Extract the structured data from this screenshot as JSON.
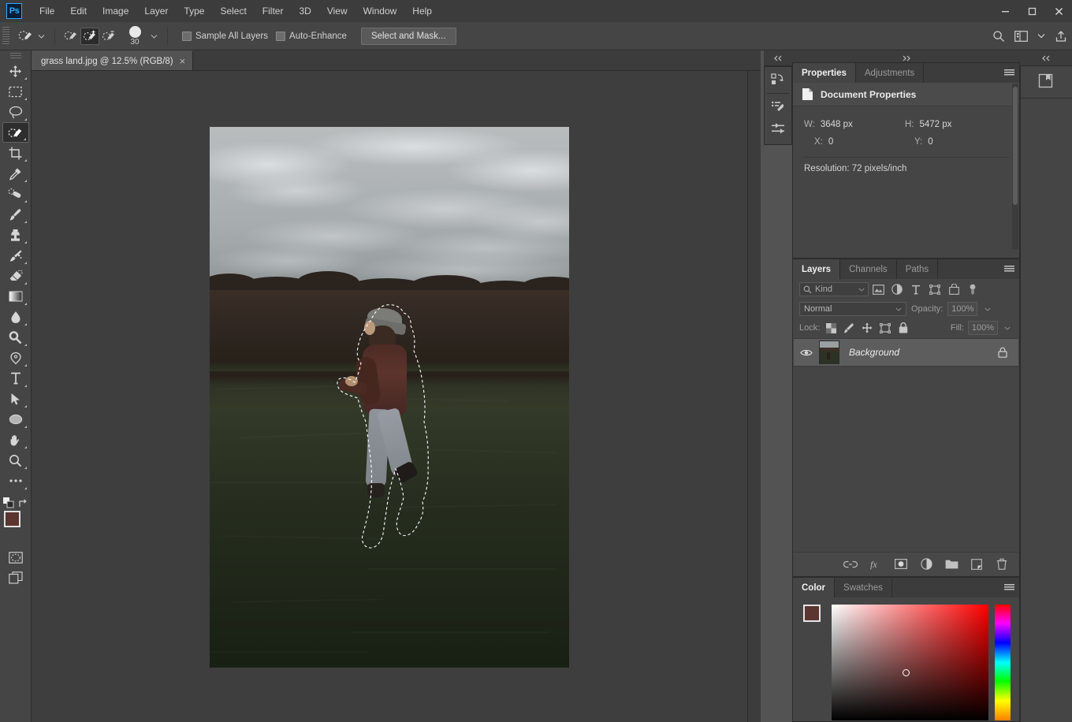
{
  "app": {
    "logo": "Ps",
    "menus": [
      "File",
      "Edit",
      "Image",
      "Layer",
      "Type",
      "Select",
      "Filter",
      "3D",
      "View",
      "Window",
      "Help"
    ],
    "window_controls": {
      "minimize": "minimize-icon",
      "maximize": "maximize-icon",
      "close": "close-icon"
    }
  },
  "options_bar": {
    "tool_preset_icon": "quick-selection-tool-icon",
    "modes": [
      {
        "name": "new-selection",
        "active": false
      },
      {
        "name": "add-to-selection",
        "active": true
      },
      {
        "name": "subtract-from-selection",
        "active": false
      }
    ],
    "brush_size": "30",
    "checkboxes": [
      {
        "label": "Sample All Layers",
        "checked": false
      },
      {
        "label": "Auto-Enhance",
        "checked": false
      }
    ],
    "select_and_mask_label": "Select and Mask...",
    "right_icons": [
      "search-icon",
      "workspace-icon",
      "chevron-down-icon",
      "share-icon"
    ]
  },
  "toolbar": {
    "tools": [
      {
        "name": "move-tool",
        "selected": false
      },
      {
        "name": "rectangular-marquee-tool",
        "selected": false
      },
      {
        "name": "lasso-tool",
        "selected": false
      },
      {
        "name": "quick-selection-tool",
        "selected": true
      },
      {
        "name": "crop-tool",
        "selected": false
      },
      {
        "name": "eyedropper-tool",
        "selected": false
      },
      {
        "name": "spot-healing-brush-tool",
        "selected": false
      },
      {
        "name": "brush-tool",
        "selected": false
      },
      {
        "name": "clone-stamp-tool",
        "selected": false
      },
      {
        "name": "history-brush-tool",
        "selected": false
      },
      {
        "name": "eraser-tool",
        "selected": false
      },
      {
        "name": "gradient-tool",
        "selected": false
      },
      {
        "name": "blur-tool",
        "selected": false
      },
      {
        "name": "dodge-tool",
        "selected": false
      },
      {
        "name": "pen-tool",
        "selected": false
      },
      {
        "name": "type-tool",
        "selected": false
      },
      {
        "name": "path-selection-tool",
        "selected": false
      },
      {
        "name": "ellipse-tool",
        "selected": false
      },
      {
        "name": "hand-tool",
        "selected": false
      },
      {
        "name": "zoom-tool",
        "selected": false
      },
      {
        "name": "edit-toolbar-tool",
        "selected": false
      }
    ],
    "foreground_color": "#5c3530",
    "background_color": "#ffffff",
    "quick_mask": "quick-mask-icon",
    "screen_mode": "screen-mode-icon"
  },
  "document": {
    "tab_title": "grass land.jpg @ 12.5% (RGB/8)",
    "close_label": "×",
    "zoom": "12.5%",
    "color_mode": "RGB/8",
    "filename": "grass land.jpg"
  },
  "properties_panel": {
    "tabs": [
      {
        "label": "Properties",
        "active": true
      },
      {
        "label": "Adjustments",
        "active": false
      }
    ],
    "header": "Document Properties",
    "header_icon": "document-icon",
    "width_label": "W:",
    "width_value": "3648 px",
    "height_label": "H:",
    "height_value": "5472 px",
    "x_label": "X:",
    "x_value": "0",
    "y_label": "Y:",
    "y_value": "0",
    "resolution": "Resolution: 72 pixels/inch",
    "menu_icon": "panel-menu-icon"
  },
  "layers_panel": {
    "tabs": [
      {
        "label": "Layers",
        "active": true
      },
      {
        "label": "Channels",
        "active": false
      },
      {
        "label": "Paths",
        "active": false
      }
    ],
    "filter_label": "Kind",
    "filter_icons": [
      "pixel-layer-filter-icon",
      "adjustment-layer-filter-icon",
      "type-layer-filter-icon",
      "shape-layer-filter-icon",
      "smart-object-filter-icon",
      "toggle-filter-icon"
    ],
    "blend_mode": "Normal",
    "opacity_label": "Opacity:",
    "opacity_value": "100%",
    "lock_label": "Lock:",
    "lock_icons": [
      "lock-transparent-pixels-icon",
      "lock-image-pixels-icon",
      "lock-position-icon",
      "lock-artboard-icon",
      "lock-all-icon"
    ],
    "fill_label": "Fill:",
    "fill_value": "100%",
    "layers": [
      {
        "name": "Background",
        "visible": true,
        "locked": true
      }
    ],
    "footer_icons": [
      "link-layers-icon",
      "layer-style-fx-icon",
      "add-layer-mask-icon",
      "new-adjustment-layer-icon",
      "new-group-icon",
      "new-layer-icon",
      "delete-layer-icon"
    ],
    "menu_icon": "panel-menu-icon"
  },
  "color_panel": {
    "tabs": [
      {
        "label": "Color",
        "active": true
      },
      {
        "label": "Swatches",
        "active": false
      }
    ],
    "foreground_color": "#5c3530",
    "background_color": "#ffffff",
    "menu_icon": "panel-menu-icon"
  },
  "collapsed_dock": {
    "icons": [
      "history-icon",
      "brush-settings-icon",
      "adjustments-sliders-icon"
    ]
  },
  "right_dock": {
    "icons": [
      "libraries-icon"
    ]
  },
  "canvas": {
    "selection_active": true,
    "selection_name": "marching-ants-selection",
    "image_description": "grass field with person"
  }
}
